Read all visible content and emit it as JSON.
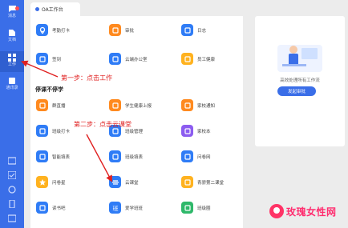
{
  "sidebar": {
    "items": [
      {
        "label": "消息",
        "icon": "message-icon",
        "badge": true
      },
      {
        "label": "文档",
        "icon": "document-icon"
      },
      {
        "label": "工作",
        "icon": "grid-icon",
        "active": true
      },
      {
        "label": "通讯录",
        "icon": "contacts-icon"
      }
    ]
  },
  "tabbar": {
    "tab_label": "OA工作台"
  },
  "apps_top": [
    {
      "label": "考勤打卡",
      "icon": "location-pin-icon",
      "color": "#2f7cf6"
    },
    {
      "label": "审批",
      "icon": "approval-icon",
      "color": "#ff8a1f"
    },
    {
      "label": "日志",
      "icon": "log-icon",
      "color": "#2f7cf6"
    },
    {
      "label": "签到",
      "icon": "checkin-icon",
      "color": "#2f7cf6"
    },
    {
      "label": "云端办公室",
      "icon": "cloud-office-icon",
      "color": "#2f7cf6"
    },
    {
      "label": "员工健康",
      "icon": "health-icon",
      "color": "#ffb21f"
    }
  ],
  "section_title": "停课不停学",
  "apps_school": [
    {
      "label": "群直播",
      "icon": "live-icon",
      "color": "#ff8a1f"
    },
    {
      "label": "学生健康上报",
      "icon": "health-report-icon",
      "color": "#ff8a1f"
    },
    {
      "label": "家校通知",
      "icon": "notify-icon",
      "color": "#ff8a1f"
    },
    {
      "label": "班级打卡",
      "icon": "class-checkin-icon",
      "color": "#2f7cf6"
    },
    {
      "label": "班级管理",
      "icon": "class-manage-icon",
      "color": "#2f7cf6"
    },
    {
      "label": "家校本",
      "icon": "homework-icon",
      "color": "#8c5cf0"
    },
    {
      "label": "智能填表",
      "icon": "smart-form-icon",
      "color": "#2f7cf6"
    },
    {
      "label": "班级填表",
      "icon": "class-form-icon",
      "color": "#2f7cf6"
    },
    {
      "label": "问卷网",
      "icon": "survey-web-icon",
      "color": "#2f7cf6"
    },
    {
      "label": "问卷星",
      "icon": "survey-star-icon",
      "color": "#ffb21f"
    },
    {
      "label": "云课堂",
      "icon": "cloud-class-icon",
      "color": "#2f7cf6"
    },
    {
      "label": "青骄第二课堂",
      "icon": "second-class-icon",
      "color": "#ffb21f"
    },
    {
      "label": "读书吧",
      "icon": "reading-icon",
      "color": "#2f7cf6"
    },
    {
      "label": "爱学班班",
      "icon": "aixue-icon",
      "color": "#2f7cf6"
    },
    {
      "label": "班级圈",
      "icon": "class-circle-icon",
      "color": "#2fb86a"
    }
  ],
  "annotations": {
    "step1": "第一步：点击工作",
    "step2": "第二步：点击云课堂"
  },
  "side_panel": {
    "promo_text": "高效处理所有工作流",
    "button_label": "发起审批"
  },
  "watermark": {
    "text": "玫瑰女性网"
  }
}
